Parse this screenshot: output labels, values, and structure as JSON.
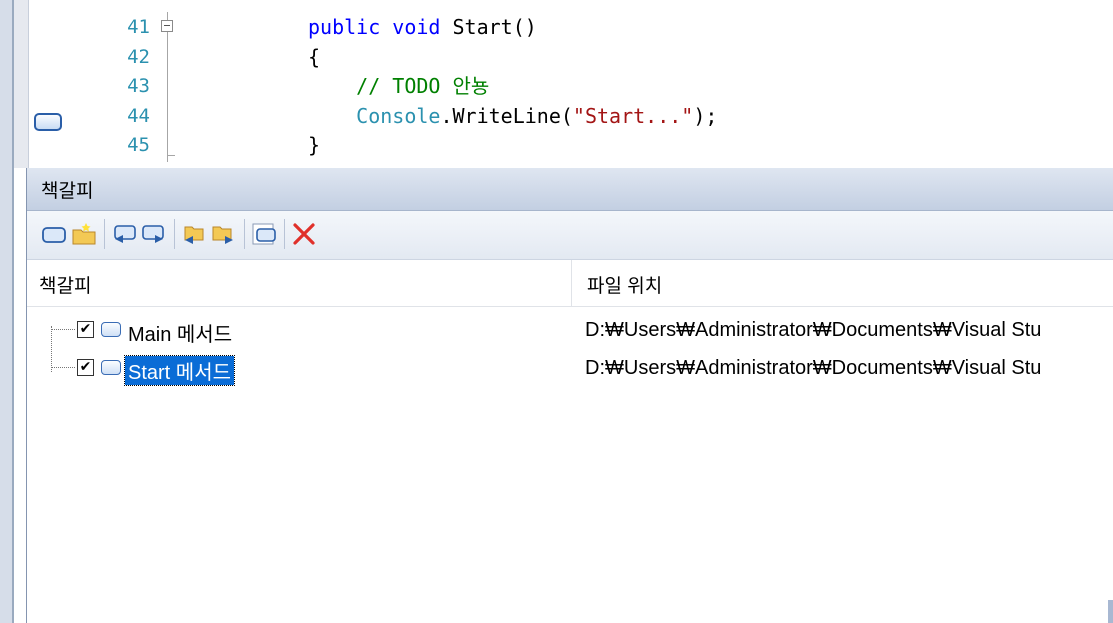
{
  "editor": {
    "lines": [
      {
        "number": "41",
        "segments": [
          {
            "cls": "kw",
            "text": "public void "
          },
          {
            "cls": "plain",
            "text": "Start()"
          }
        ]
      },
      {
        "number": "42",
        "segments": [
          {
            "cls": "plain",
            "text": "{"
          }
        ]
      },
      {
        "number": "43",
        "segments": [
          {
            "cls": "cmt",
            "text": "    // TODO 안뇽"
          }
        ]
      },
      {
        "number": "44",
        "segments": [
          {
            "cls": "cls",
            "text": "    Console"
          },
          {
            "cls": "plain",
            "text": ".WriteLine("
          },
          {
            "cls": "str",
            "text": "\"Start...\""
          },
          {
            "cls": "plain",
            "text": ");"
          }
        ]
      },
      {
        "number": "45",
        "segments": [
          {
            "cls": "plain",
            "text": "}"
          }
        ]
      }
    ]
  },
  "bookmarks_window": {
    "title": "책갈피",
    "toolbar": [
      {
        "name": "toggle-bookmark-button",
        "icon": "bookmark-icon"
      },
      {
        "name": "new-folder-button",
        "icon": "new-folder-icon"
      },
      {
        "name": "previous-bookmark-button",
        "icon": "previous-bookmark-icon"
      },
      {
        "name": "next-bookmark-button",
        "icon": "next-bookmark-icon"
      },
      {
        "name": "previous-bookmark-in-folder-button",
        "icon": "previous-folder-bookmark-icon"
      },
      {
        "name": "next-bookmark-in-folder-button",
        "icon": "next-folder-bookmark-icon"
      },
      {
        "name": "toggle-all-bookmarks-button",
        "icon": "disable-bookmarks-icon"
      },
      {
        "name": "delete-bookmark-button",
        "icon": "delete-icon"
      }
    ],
    "columns": {
      "name": "책갈피",
      "location": "파일 위치"
    },
    "rows": [
      {
        "checked": true,
        "name": "Main 메서드",
        "location": "D:₩Users₩Administrator₩Documents₩Visual Stu",
        "selected": false
      },
      {
        "checked": true,
        "name": "Start 메서드",
        "location": "D:₩Users₩Administrator₩Documents₩Visual Stu",
        "selected": true
      }
    ]
  },
  "colors": {
    "accent": "#0a6cd6",
    "keyword": "#0000ff",
    "comment": "#008000",
    "type": "#2b91af",
    "string": "#a31515"
  }
}
